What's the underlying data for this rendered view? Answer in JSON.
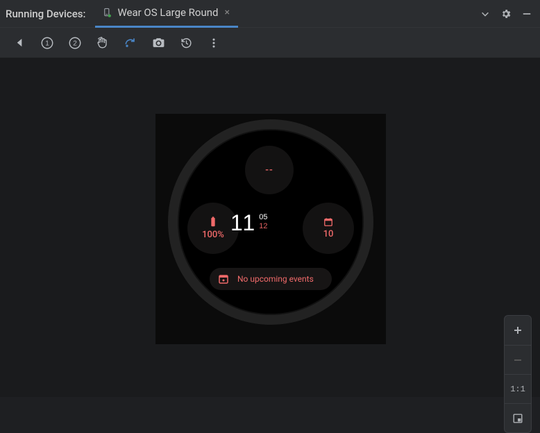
{
  "header": {
    "title": "Running Devices:",
    "tab_label": "Wear OS Large Round"
  },
  "zoom": {
    "one_to_one": "1:1"
  },
  "watchface": {
    "top_complication": "--",
    "battery": "100%",
    "calendar_day": "10",
    "hours": "11",
    "minutes": "05",
    "seconds": "12",
    "event_text": "No upcoming events"
  },
  "colors": {
    "accent": "#f06a6a"
  }
}
